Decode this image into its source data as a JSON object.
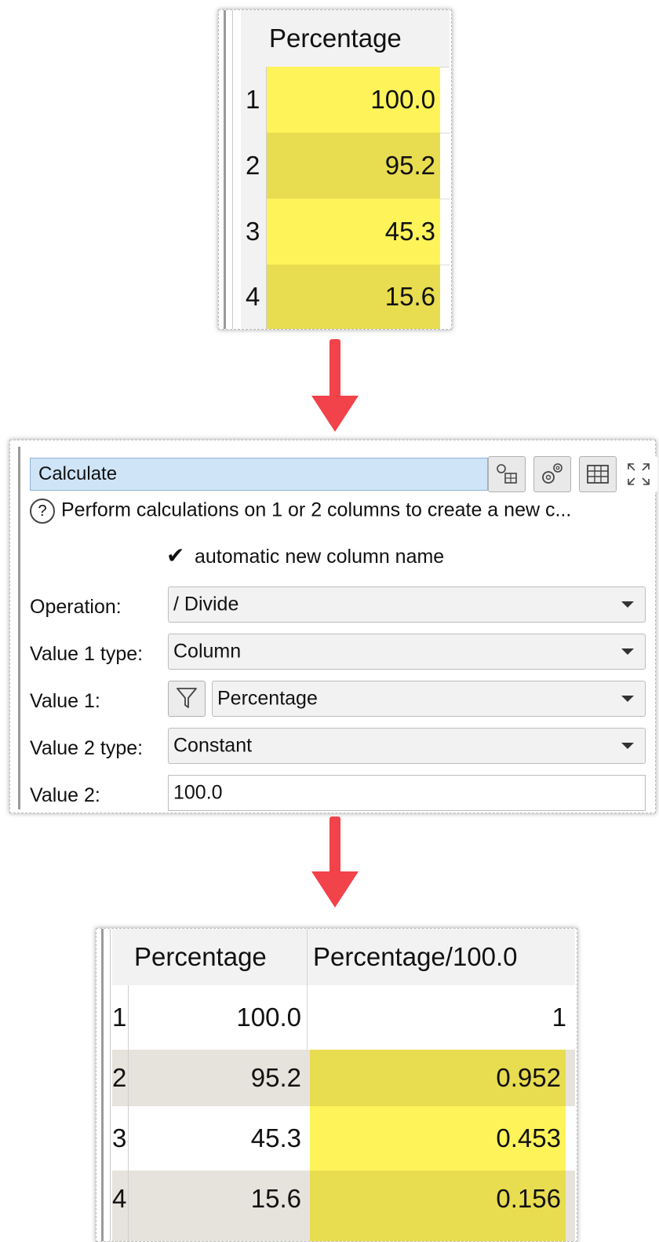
{
  "input_table": {
    "columns": [
      "Percentage"
    ],
    "rows": [
      {
        "num": "1",
        "percentage": "100.0"
      },
      {
        "num": "2",
        "percentage": "95.2"
      },
      {
        "num": "3",
        "percentage": "45.3"
      },
      {
        "num": "4",
        "percentage": "15.6"
      }
    ]
  },
  "calculate_panel": {
    "title": "Calculate",
    "description": "Perform calculations on 1 or 2 columns to create a new c...",
    "help_icon": "?",
    "auto_name_label": "automatic new column name",
    "auto_name_checked": true,
    "checkmark": "✔",
    "operation_label": "Operation:",
    "operation_value": "/ Divide",
    "value1_type_label": "Value 1 type:",
    "value1_type_value": "Column",
    "value1_label": "Value 1:",
    "value1_value": "Percentage",
    "value2_type_label": "Value 2 type:",
    "value2_type_value": "Constant",
    "value2_label": "Value 2:",
    "value2_value": "100.0",
    "toolbar_icons": [
      "column-settings-icon",
      "gears-icon",
      "table-icon",
      "maximize-icon"
    ]
  },
  "output_table": {
    "columns": [
      "Percentage",
      "Percentage/100.0"
    ],
    "rows": [
      {
        "num": "1",
        "percentage": "100.0",
        "result": "1"
      },
      {
        "num": "2",
        "percentage": "95.2",
        "result": "0.952"
      },
      {
        "num": "3",
        "percentage": "45.3",
        "result": "0.453"
      },
      {
        "num": "4",
        "percentage": "15.6",
        "result": "0.156"
      }
    ]
  },
  "colors": {
    "highlight_light": "#fff35a",
    "highlight_dark": "#e8dc50",
    "arrow": "#f2424a",
    "title_bg": "#cfe4f7"
  }
}
